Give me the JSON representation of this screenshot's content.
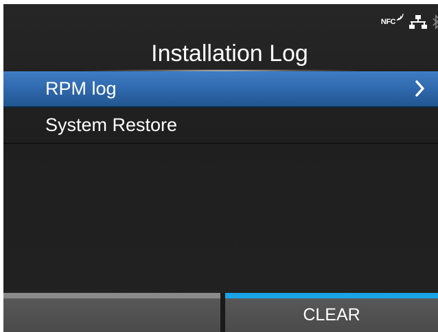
{
  "status": {
    "nfc_label": "NFC",
    "icons": [
      "nfc-icon",
      "lan-icon",
      "bluetooth-icon"
    ]
  },
  "header": {
    "title": "Installation Log"
  },
  "menu": {
    "items": [
      {
        "label": "RPM log",
        "selected": true,
        "has_submenu": true
      },
      {
        "label": "System Restore",
        "selected": false,
        "has_submenu": false
      }
    ]
  },
  "function_bar": {
    "left_label": "",
    "right_label": "CLEAR"
  },
  "colors": {
    "selection": "#2f68ad",
    "active_indicator": "#1aa3e6",
    "inactive_indicator": "#8a8a8a",
    "background": "#222222"
  }
}
